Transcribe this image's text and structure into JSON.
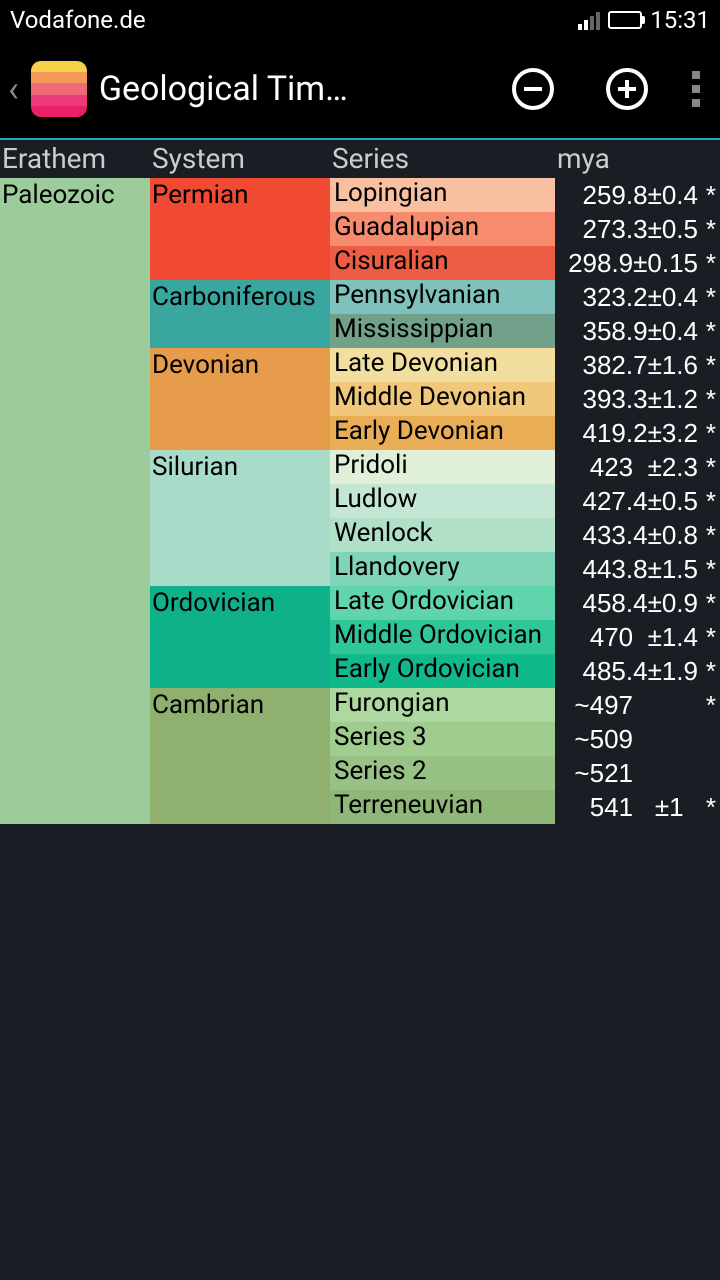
{
  "status": {
    "carrier": "Vodafone.de",
    "time": "15:31"
  },
  "header": {
    "title": "Geological Tim…"
  },
  "columns": {
    "c1": "Erathem",
    "c2": "System",
    "c3": "Series",
    "c4": "mya"
  },
  "erathem": {
    "name": "Paleozoic",
    "color": "#9ccb9c"
  },
  "systems": [
    {
      "name": "Permian",
      "color": "#f04a33",
      "rows": 3
    },
    {
      "name": "Carboniferous",
      "color": "#3aa6a0",
      "rows": 2
    },
    {
      "name": "Devonian",
      "color": "#e69c4a",
      "rows": 3
    },
    {
      "name": "Silurian",
      "color": "#a8dcc8",
      "rows": 4
    },
    {
      "name": "Ordovician",
      "color": "#0fb18a",
      "rows": 3
    },
    {
      "name": "Cambrian",
      "color": "#8fb06e",
      "rows": 4
    }
  ],
  "series": [
    {
      "name": "Lopingian",
      "color": "#f8bfa0",
      "mya": "259.8±0.4",
      "star": true
    },
    {
      "name": "Guadalupian",
      "color": "#f68c6d",
      "mya": "273.3±0.5",
      "star": true
    },
    {
      "name": "Cisuralian",
      "color": "#ed5d45",
      "mya": "298.9±0.15",
      "star": true
    },
    {
      "name": "Pennsylvanian",
      "color": "#7fc1bb",
      "mya": "323.2±0.4",
      "star": true
    },
    {
      "name": "Mississippian",
      "color": "#71a18a",
      "mya": "358.9±0.4",
      "star": true
    },
    {
      "name": "Late Devonian",
      "color": "#f2dfa0",
      "mya": "382.7±1.6",
      "star": true
    },
    {
      "name": "Middle Devonian",
      "color": "#f0c77b",
      "mya": "393.3±1.2",
      "star": true
    },
    {
      "name": "Early Devonian",
      "color": "#e9ae55",
      "mya": "419.2±3.2",
      "star": true
    },
    {
      "name": "Pridoli",
      "color": "#e0f0d8",
      "mya": "   423  ±2.3",
      "star": true
    },
    {
      "name": "Ludlow",
      "color": "#c4e6d4",
      "mya": "427.4±0.5",
      "star": true
    },
    {
      "name": "Wenlock",
      "color": "#b0e0c8",
      "mya": "433.4±0.8",
      "star": true
    },
    {
      "name": "Llandovery",
      "color": "#80d4b8",
      "mya": "443.8±1.5",
      "star": true
    },
    {
      "name": "Late Ordovician",
      "color": "#60d4ac",
      "mya": "458.4±0.9",
      "star": true
    },
    {
      "name": "Middle Ordovician",
      "color": "#2fc79a",
      "mya": "   470  ±1.4",
      "star": true
    },
    {
      "name": "Early Ordovician",
      "color": "#0fb98a",
      "mya": "485.4±1.9",
      "star": true
    },
    {
      "name": "Furongian",
      "color": "#add8a0",
      "mya": "~497         ",
      "star": true
    },
    {
      "name": "Series 3",
      "color": "#a0cc90",
      "mya": "~509         ",
      "star": false
    },
    {
      "name": "Series 2",
      "color": "#98c285",
      "mya": "~521         ",
      "star": false
    },
    {
      "name": "Terreneuvian",
      "color": "#8fb878",
      "mya": "   541   ±1  ",
      "star": true
    }
  ]
}
